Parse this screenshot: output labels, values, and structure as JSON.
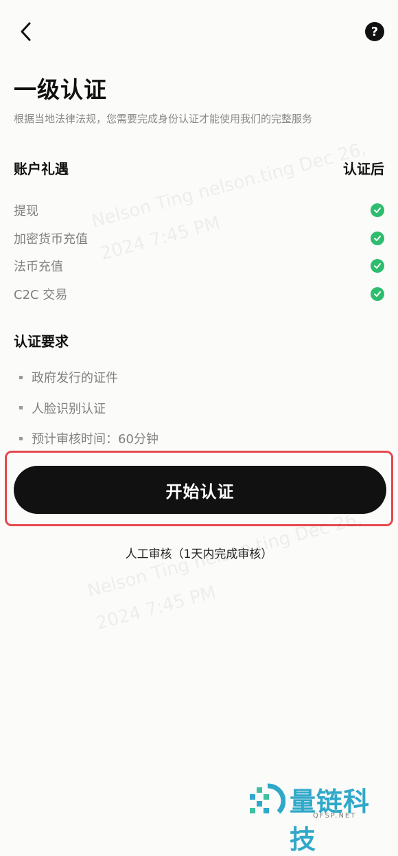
{
  "header": {
    "back_icon": "chevron-left-icon",
    "help_icon": "question-circle-icon",
    "help_glyph": "?"
  },
  "page": {
    "title": "一级认证",
    "subtitle": "根据当地法律法规，您需要完成身份认证才能使用我们的完整服务"
  },
  "benefits": {
    "heading": "账户礼遇",
    "after_label": "认证后",
    "check_color": "#2ebd6e",
    "items": [
      {
        "label": "提现",
        "enabled_after": true
      },
      {
        "label": "加密货币充值",
        "enabled_after": true
      },
      {
        "label": "法币充值",
        "enabled_after": true
      },
      {
        "label": "C2C 交易",
        "enabled_after": true
      }
    ]
  },
  "requirements": {
    "heading": "认证要求",
    "items": [
      {
        "label": "政府发行的证件"
      },
      {
        "label": "人脸识别认证"
      },
      {
        "label": "预计审核时间：60分钟"
      }
    ]
  },
  "action": {
    "start_label": "开始认证",
    "highlight_color": "#e5484d",
    "review_note": "人工审核（1天内完成审核）"
  },
  "watermark": {
    "line1": "Nelson Ting nelson.ting Dec 26,",
    "line2": "2024 7:45 PM"
  },
  "brand": {
    "name": "量链科技",
    "site": "QFSP.NET",
    "color": "#2fa8c9"
  }
}
